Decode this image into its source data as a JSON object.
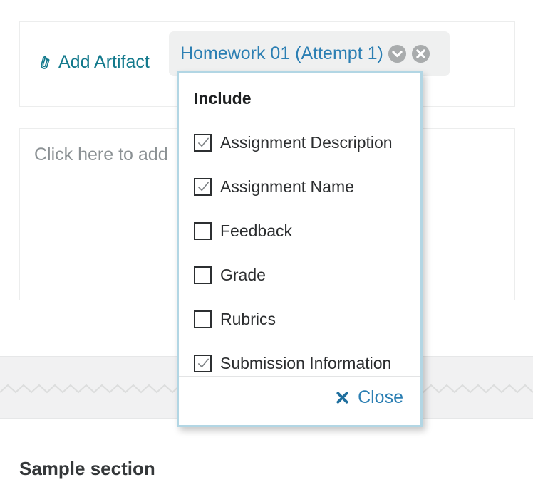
{
  "artifact_card": {
    "add_artifact_label": "Add Artifact",
    "paperclip_icon": "paperclip-icon"
  },
  "notes_card": {
    "placeholder": "Click here to add"
  },
  "artifact_tag": {
    "label": "Homework 01 (Attempt 1)",
    "expand_icon": "chevron-down-circle-icon",
    "remove_icon": "close-circle-icon",
    "background": "#eff0f0",
    "label_color": "#2c7fb3",
    "icon_color": "#a9acad"
  },
  "include_popup": {
    "title": "Include",
    "border_color": "#b2d6e4",
    "options": [
      {
        "label": "Assignment Description",
        "checked": true
      },
      {
        "label": "Assignment Name",
        "checked": true
      },
      {
        "label": "Feedback",
        "checked": false
      },
      {
        "label": "Grade",
        "checked": false
      },
      {
        "label": "Rubrics",
        "checked": false
      },
      {
        "label": "Submission Information",
        "checked": true
      }
    ],
    "close_label": "Close",
    "close_icon": "x-icon",
    "close_color": "#2c7fb3"
  },
  "section": {
    "title": "Sample section",
    "band_color": "#f1f1f2"
  },
  "theme": {
    "link_teal": "#12798c",
    "link_blue": "#2c7fb3",
    "text_dark": "#2b2b2b",
    "placeholder_gray": "#8b9194"
  }
}
